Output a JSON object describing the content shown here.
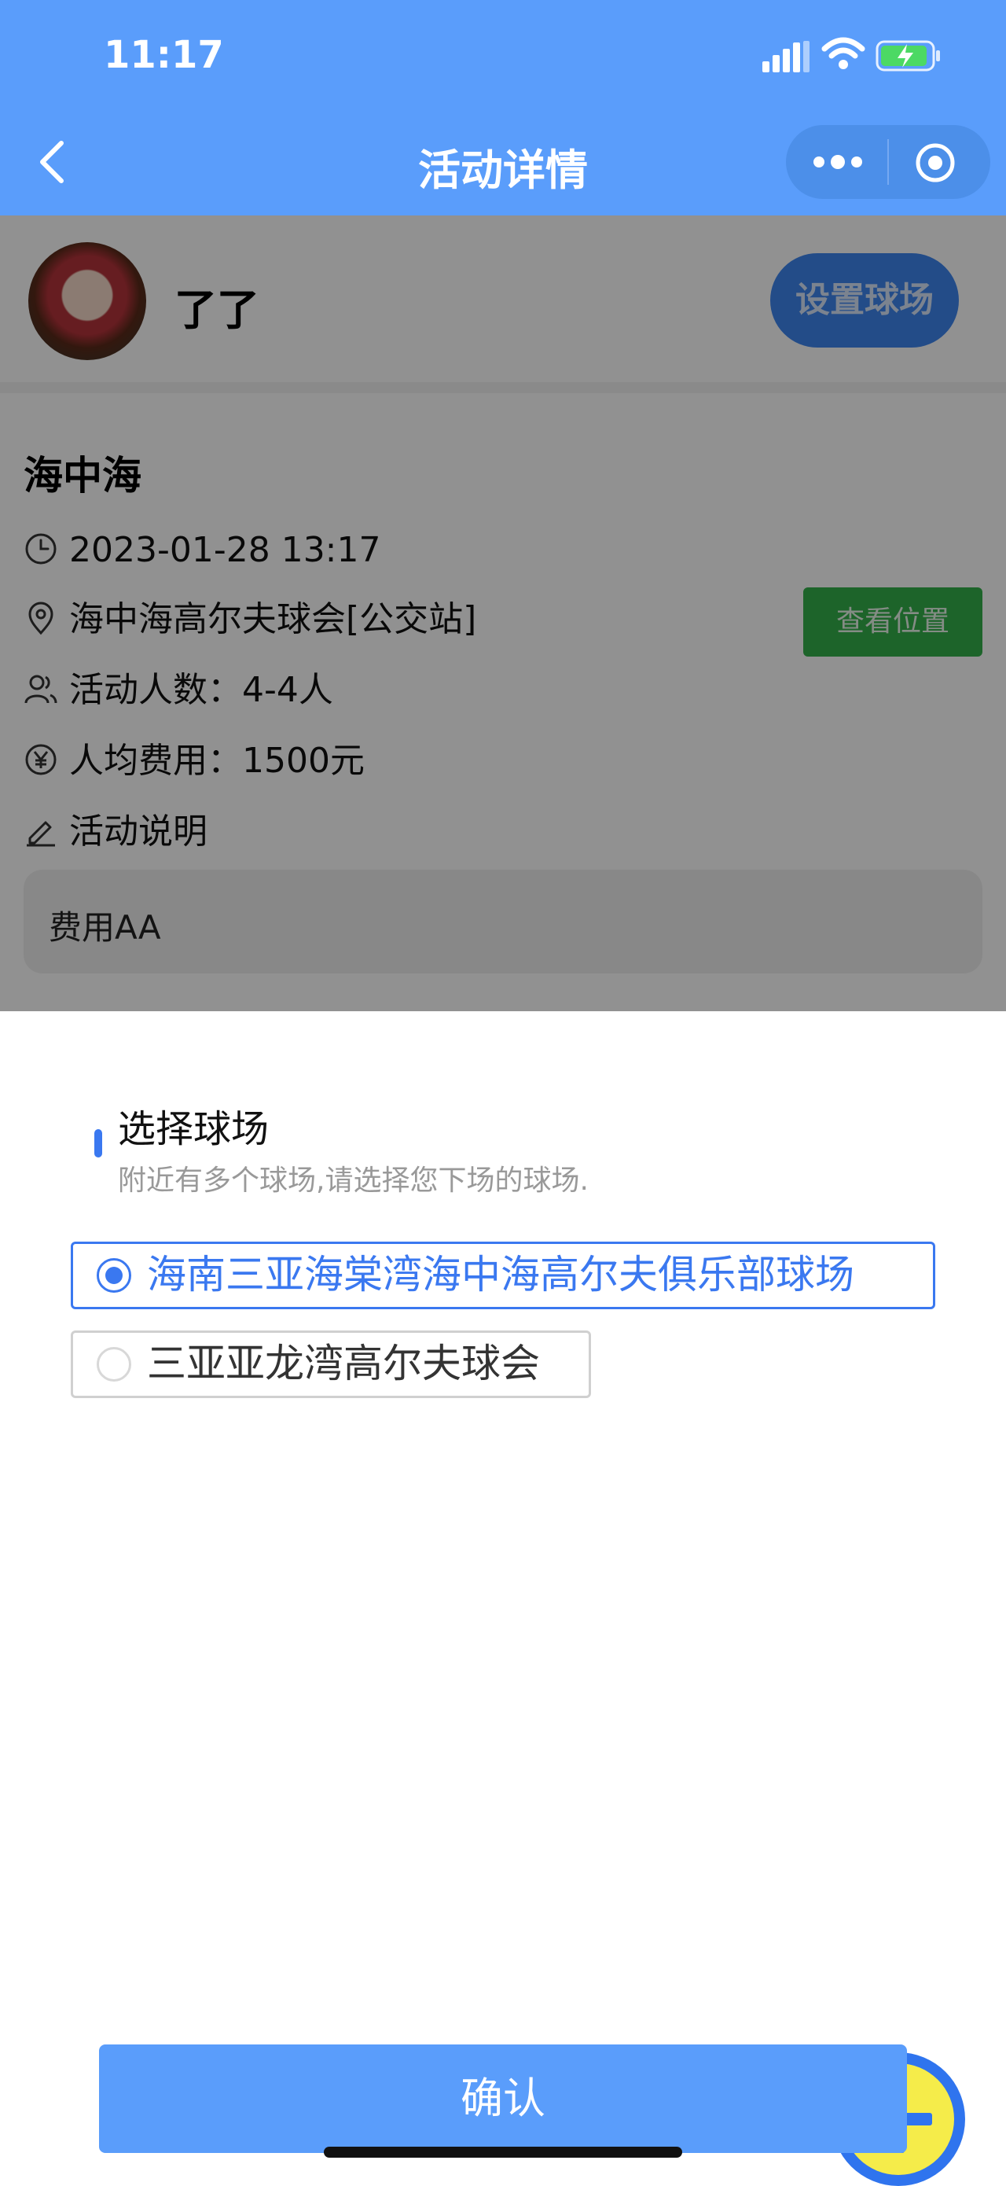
{
  "status_bar": {
    "time": "11:17"
  },
  "nav": {
    "title": "活动详情"
  },
  "host": {
    "name": "了了",
    "set_course_label": "设置球场"
  },
  "activity": {
    "name": "海中海",
    "datetime": "2023-01-28 13:17",
    "location": "海中海高尔夫球会[公交站]",
    "view_location_label": "查看位置",
    "people": "活动人数：4-4人",
    "fee": "人均费用：1500元",
    "description_label": "活动说明",
    "description": "费用AA"
  },
  "sheet": {
    "title": "选择球场",
    "subtitle": "附近有多个球场,请选择您下场的球场.",
    "options": [
      {
        "label": "海南三亚海棠湾海中海高尔夫俱乐部球场",
        "selected": true
      },
      {
        "label": "三亚亚龙湾高尔夫球会",
        "selected": false
      }
    ],
    "confirm_label": "确认"
  },
  "colors": {
    "primary": "#5a9dfb",
    "accent": "#3a78f0",
    "green": "#34b04a",
    "fab_fill": "#f5ec4a"
  }
}
